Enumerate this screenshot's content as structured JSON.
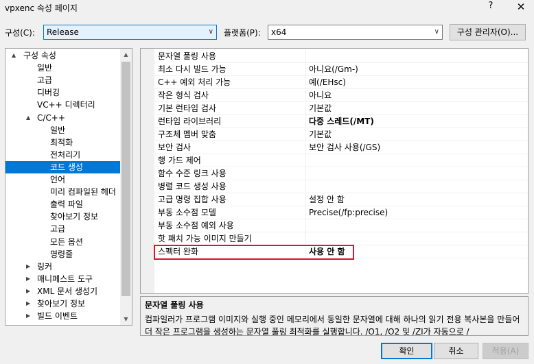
{
  "window": {
    "title": "vpxenc 속성 페이지",
    "help": "?",
    "close": "✕"
  },
  "toolbar": {
    "config_label": "구성(C):",
    "config_value": "Release",
    "platform_label": "플랫폼(P):",
    "platform_value": "x64",
    "config_manager_label": "구성 관리자(O)..."
  },
  "tree": {
    "items": [
      {
        "label": "구성 속성",
        "level": 0,
        "expander": "▲"
      },
      {
        "label": "일반",
        "level": 1
      },
      {
        "label": "고급",
        "level": 1
      },
      {
        "label": "디버깅",
        "level": 1
      },
      {
        "label": "VC++ 디렉터리",
        "level": 1
      },
      {
        "label": "C/C++",
        "level": 1,
        "expander": "▲"
      },
      {
        "label": "일반",
        "level": 2
      },
      {
        "label": "최적화",
        "level": 2
      },
      {
        "label": "전처리기",
        "level": 2
      },
      {
        "label": "코드 생성",
        "level": 2,
        "selected": true
      },
      {
        "label": "언어",
        "level": 2
      },
      {
        "label": "미리 컴파일된 헤더",
        "level": 2
      },
      {
        "label": "출력 파일",
        "level": 2
      },
      {
        "label": "찾아보기 정보",
        "level": 2
      },
      {
        "label": "고급",
        "level": 2
      },
      {
        "label": "모든 옵션",
        "level": 2
      },
      {
        "label": "명령줄",
        "level": 2
      },
      {
        "label": "링커",
        "level": 1,
        "expander": "▶"
      },
      {
        "label": "매니페스트 도구",
        "level": 1,
        "expander": "▶"
      },
      {
        "label": "XML 문서 생성기",
        "level": 1,
        "expander": "▶"
      },
      {
        "label": "찾아보기 정보",
        "level": 1,
        "expander": "▶"
      },
      {
        "label": "빌드 이벤트",
        "level": 1,
        "expander": "▶"
      }
    ]
  },
  "properties": [
    {
      "name": "문자열 풀링 사용",
      "value": ""
    },
    {
      "name": "최소 다시 빌드 가능",
      "value": "아니요(/Gm-)"
    },
    {
      "name": "C++ 예외 처리 가능",
      "value": "예(/EHsc)"
    },
    {
      "name": "작은 형식 검사",
      "value": "아니요"
    },
    {
      "name": "기본 런타임 검사",
      "value": "기본값"
    },
    {
      "name": "런타임 라이브러리",
      "value": "다중 스레드(/MT)",
      "bold": true
    },
    {
      "name": "구조체 멤버 맞춤",
      "value": "기본값"
    },
    {
      "name": "보안 검사",
      "value": "보안 검사 사용(/GS)"
    },
    {
      "name": "행 가드 제어",
      "value": ""
    },
    {
      "name": "함수 수준 링크 사용",
      "value": ""
    },
    {
      "name": "병렬 코드 생성 사용",
      "value": ""
    },
    {
      "name": "고급 명령 집합 사용",
      "value": "설정 안 함"
    },
    {
      "name": "부동 소수점 모델",
      "value": "Precise(/fp:precise)"
    },
    {
      "name": "부동 소수점 예외 사용",
      "value": ""
    },
    {
      "name": "핫 패치 가능 이미지 만들기",
      "value": ""
    },
    {
      "name": "스펙터 완화",
      "value": "사용 안 함",
      "bold": true
    }
  ],
  "description": {
    "title": "문자열 풀링 사용",
    "text": "컴파일러가 프로그램 이미지와 실행 중인 메모리에서 동일한 문자열에 대해 하나의 읽기 전용 복사본을 만들어 더 작은 프로그램을 생성하는 문자열 풀링 최적화를 실행합니다. /O1, /O2 및 /ZI가 자동으로 /"
  },
  "buttons": {
    "ok": "확인",
    "cancel": "취소",
    "apply": "적용(A)"
  },
  "colors": {
    "selection": "#0078d7",
    "highlight_box": "#e81123"
  }
}
